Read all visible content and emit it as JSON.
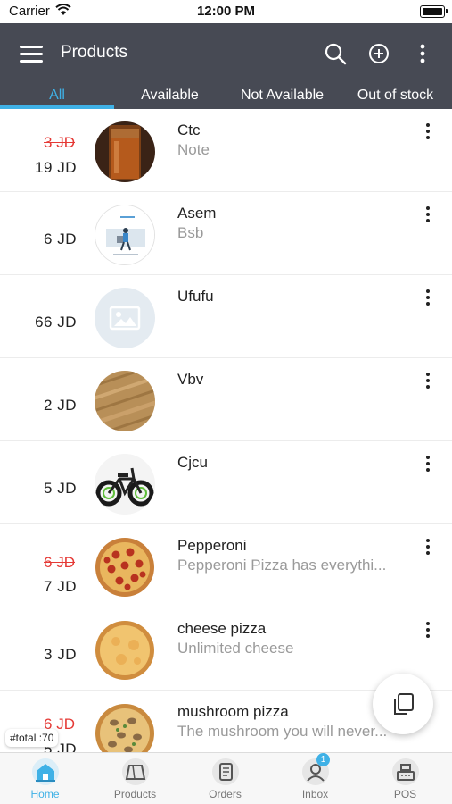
{
  "status_bar": {
    "carrier": "Carrier",
    "time": "12:00 PM"
  },
  "header": {
    "title": "Products",
    "icons": [
      "menu-icon",
      "search-icon",
      "add-circle-icon",
      "more-vertical-icon"
    ]
  },
  "tabs": [
    {
      "label": "All",
      "active": true
    },
    {
      "label": "Available",
      "active": false
    },
    {
      "label": "Not Available",
      "active": false
    },
    {
      "label": "Out of stock",
      "active": false
    }
  ],
  "products": [
    {
      "name": "Ctc",
      "description": "Note",
      "old_price": "3 JD",
      "price": "19 JD",
      "image": "glass-jar-photo"
    },
    {
      "name": "Asem",
      "description": "Bsb",
      "old_price": "",
      "price": "6 JD",
      "image": "person-illustration"
    },
    {
      "name": "Ufufu",
      "description": "",
      "old_price": "",
      "price": "66 JD",
      "image": "image-placeholder-icon"
    },
    {
      "name": "Vbv",
      "description": "",
      "old_price": "",
      "price": "2 JD",
      "image": "wood-texture-photo"
    },
    {
      "name": "Cjcu",
      "description": "",
      "old_price": "",
      "price": "5 JD",
      "image": "electric-bike-photo"
    },
    {
      "name": "Pepperoni",
      "description": "Pepperoni Pizza has everythi...",
      "old_price": "6 JD",
      "price": "7 JD",
      "image": "pepperoni-pizza-photo"
    },
    {
      "name": "cheese pizza",
      "description": "Unlimited cheese",
      "old_price": "",
      "price": "3 JD",
      "image": "cheese-pizza-photo"
    },
    {
      "name": "mushroom pizza",
      "description": "The mushroom you will never...",
      "old_price": "6 JD",
      "price": "5 JD",
      "image": "mushroom-pizza-photo"
    }
  ],
  "total_label": "#total :70",
  "fab_icon": "copy-icon",
  "bottom_nav": [
    {
      "label": "Home",
      "icon": "home-icon",
      "active": true,
      "badge": ""
    },
    {
      "label": "Products",
      "icon": "products-icon",
      "active": false,
      "badge": ""
    },
    {
      "label": "Orders",
      "icon": "orders-icon",
      "active": false,
      "badge": ""
    },
    {
      "label": "Inbox",
      "icon": "inbox-icon",
      "active": false,
      "badge": "1"
    },
    {
      "label": "POS",
      "icon": "cash-register-icon",
      "active": false,
      "badge": ""
    }
  ],
  "colors": {
    "header_bg": "#474a54",
    "accent": "#3fb1e6",
    "discount": "#e53935",
    "muted_text": "#9a9a9a"
  }
}
